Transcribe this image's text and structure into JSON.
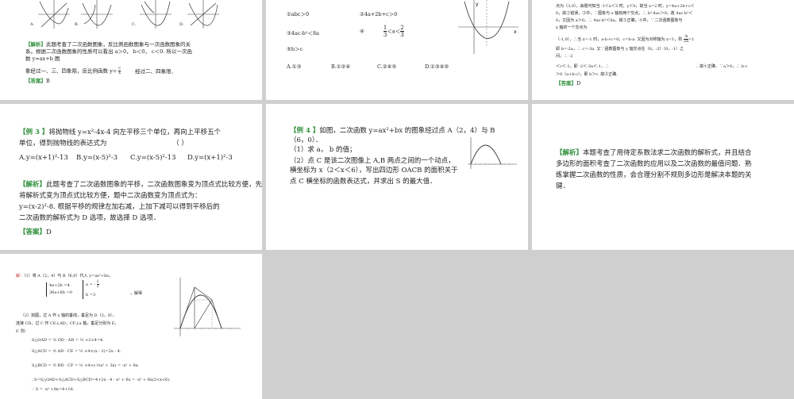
{
  "s1": {
    "opt_a": "A.",
    "opt_b": "B.",
    "opt_c": "C.",
    "opt_d": "D.",
    "analysis_tag": "【解析】",
    "analysis_1": "此题考查了二次函数图象，反比例函数图象与一次函数图象的关",
    "analysis_2": "系。根据二次函数图象的性质可以看出 a＞0， b＜0， c＜0. 所以一次函",
    "analysis_3": "数 y=ax+b 图",
    "analysis_4a": "象经过一、三、四象限，反比例函数 y=",
    "frac_num": "c",
    "frac_den": "x",
    "analysis_4b": "经过二、四象限．",
    "answer_tag": "【答案】",
    "answer": "B"
  },
  "s2": {
    "item1": "①abc＞0",
    "item2": "②4a+2b+c＞0",
    "item3": "③4ac-b²＜8a",
    "item4": "④",
    "frac1_num": "1",
    "frac1_den": "3",
    "mid": "＜a＜",
    "frac2_num": "2",
    "frac2_den": "3",
    "item5": "⑤b＞c",
    "opt_a": "A.①③",
    "opt_b": "B.①②④",
    "opt_c": "C.②④⑤",
    "opt_d": "D.①③④⑤",
    "axis_y": "y",
    "axis_x": "x"
  },
  "s3": {
    "l1": "点为（3,0），由题可知当 -1＜x＜3 时，y＜0，故当 x=2 时，y=4a+2b+c＜",
    "l2": "0，故②错误，③中，∵图象与 x 轴有两个交点，∴ b²-4ac＞0，故 4ac-b²＜",
    "l3": "0，又因为 a＞0，∴ 4ac-b²＜8a，故③正确，④中，∵二次函数图象与",
    "l4": "x 轴的一个交点为",
    "l5": "（-1,0），∴当 x=-1 时，a-b+c=0，c=b-a. 又因为对称轴为 x=1，则",
    "frac_num": "-b",
    "frac_den": "2a",
    "frac_tail": "=1",
    "l6": "即 b=-2a，∴ c=-3a. 又∵函数图象与 y 轴交点在（0，-2）（0，-1）之",
    "l7": "间，∴ -2",
    "l8": "＜c＜-1，即 -2＜-3a＜-1，∴",
    "l9": "．故④正确．∵a＞0，∴ b-c",
    "l10": "＞0（a+b-c），即 b＞c. 故⑤正确．",
    "answer_tag": "【答案】",
    "answer": "D"
  },
  "s4": {
    "ex_tag": "【例 3 】",
    "q1": "将抛物线 y=x²-4x-4 向左平移三个单位，再向上平移五个",
    "q2": "单位，得到抛物线的表达式为",
    "paren": "（        ）",
    "opt_a": "A.y=(x+1)²-13",
    "opt_b": "B.y=(x-5)²-3",
    "opt_c": "C.y=(x-5)²-13",
    "opt_d": "D.y=(x+1)²-3",
    "analysis_tag": "【解析】",
    "a1": "此题考查了二次函数图象的平移，二次函数图象变为顶点式比较方便，先",
    "a2": "将解析式变为顶点式比较方便，题中二次函数变为顶点式为：",
    "a3": "y=(x-2)²-8. 根据平移的规律左加右减，上加下减可以得到平移后的",
    "a4": "二次函数的解析式为 D 选项，故选择 D 选项．",
    "answer_tag": "【答案】",
    "answer": "D"
  },
  "s5": {
    "ex_tag": "【例 4 】",
    "q1": "如图，二次函数 y=ax²+bx 的图象经过点 A（2，4）与 B",
    "q2": "（6，0）．",
    "q3": "（1）求 a， b 的值；",
    "q4": "（2）点 C 是该二次图像上 A,B 两点之间的一个动点，",
    "q5": "横坐标为 x（2＜x＜6），写出四边形 OACB 的面积关于",
    "q6": "点 C 横坐标的函数表达式，并求出 S 的最大值．"
  },
  "s6": {
    "analysis_tag": "【解析】",
    "a1": "本题考查了用待定系数法求二次函数的解析式，并且结合",
    "a2": "多边形的面积考查了二次函数的应用以及二次函数的最值问题．熟",
    "a3": "练掌握二次函数的性质，会合理分割不规则多边形是解决本题的关",
    "a4": "键．"
  },
  "s7": {
    "sol_tag": "解：",
    "l1": "（1）将 A（2，4）与 B（6,0）代入 y=ax²+bx，",
    "eq1": "4a+2b =4",
    "eq2": "36a+6b =0",
    "res_a": "a = -",
    "res_half": "1",
    "res_two": "2",
    "res_b": "b =3",
    "solve": "，解得",
    "l2": "（2）如图，过 A 作 x 轴的垂线，垂足为 D（2，0），",
    "l3": "连接 CD，过 C 作 CE⊥AD，CF⊥x 轴，垂足分别为 E，",
    "l4": "F. 则：",
    "s_oad": "S△OAD = ½ OD · AD = ½ ×2×4=4.",
    "s_acd": "S△ACD = ½ AD · CE = ½ ×4×(x - 2)=2x - 4.",
    "s_bcd": "S△BCD = ½ BD · CF = ½ ×4×(-½x² + 3x) = -x² + 6x.",
    "s_sum": "∴S=S△OAD+S△ACD+S△BCD=4+2x - 4 - x² + 6x = -x² + 8x(2<x<6).",
    "s_last": "∴ S = -x² +8x=4+16."
  }
}
